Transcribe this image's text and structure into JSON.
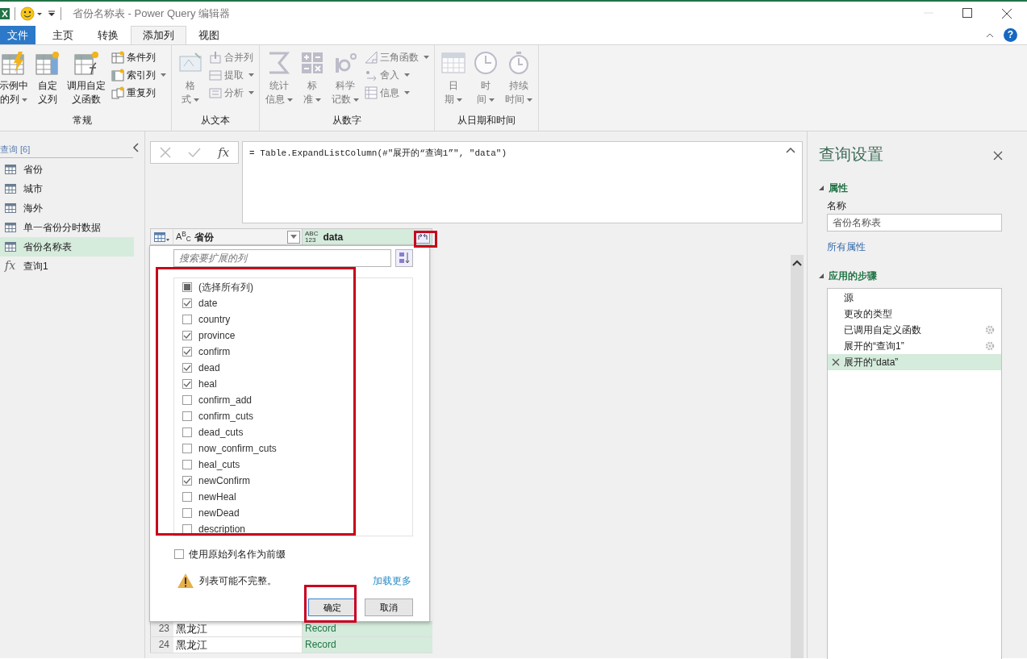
{
  "window": {
    "title": "省份名称表 - Power Query 编辑器"
  },
  "ribbon_tabs": [
    {
      "label": "文件",
      "kind": "file",
      "selected": false
    },
    {
      "label": "主页",
      "kind": "tab",
      "selected": false
    },
    {
      "label": "转换",
      "kind": "tab",
      "selected": false
    },
    {
      "label": "添加列",
      "kind": "tab",
      "selected": true
    },
    {
      "label": "视图",
      "kind": "tab",
      "selected": false
    }
  ],
  "help_button": {
    "glyph": "?"
  },
  "ribbon_groups": [
    {
      "label": "常规",
      "buttons": [
        {
          "kind": "large",
          "lines": [
            "示例中",
            "的列"
          ],
          "dropdown": true,
          "disabled": false
        },
        {
          "kind": "large",
          "lines": [
            "自定",
            "义列"
          ],
          "dropdown": false,
          "disabled": false
        },
        {
          "kind": "large",
          "lines": [
            "调用自定",
            "义函数"
          ],
          "dropdown": false,
          "disabled": false
        },
        {
          "kind": "small",
          "lines": [
            "条件列"
          ],
          "dropdown": false,
          "disabled": false
        },
        {
          "kind": "small",
          "lines": [
            "索引列"
          ],
          "dropdown": true,
          "disabled": false
        },
        {
          "kind": "small",
          "lines": [
            "重复列"
          ],
          "dropdown": false,
          "disabled": false
        }
      ]
    },
    {
      "label": "从文本",
      "buttons": [
        {
          "kind": "large",
          "lines": [
            "格",
            "式"
          ],
          "dropdown": true,
          "disabled": true
        },
        {
          "kind": "small",
          "lines": [
            "合并列"
          ],
          "dropdown": false,
          "disabled": true
        },
        {
          "kind": "small",
          "lines": [
            "提取"
          ],
          "dropdown": true,
          "disabled": true
        },
        {
          "kind": "small",
          "lines": [
            "分析"
          ],
          "dropdown": true,
          "disabled": true
        }
      ]
    },
    {
      "label": "从数字",
      "buttons": [
        {
          "kind": "large",
          "lines": [
            "统计",
            "信息"
          ],
          "dropdown": true,
          "disabled": true
        },
        {
          "kind": "large",
          "lines": [
            "标",
            "准"
          ],
          "dropdown": true,
          "disabled": true
        },
        {
          "kind": "large",
          "lines": [
            "科学",
            "记数"
          ],
          "dropdown": true,
          "disabled": true
        },
        {
          "kind": "small",
          "lines": [
            "三角函数"
          ],
          "dropdown": true,
          "disabled": true
        },
        {
          "kind": "small",
          "lines": [
            "舍入"
          ],
          "dropdown": true,
          "disabled": true
        },
        {
          "kind": "small",
          "lines": [
            "信息"
          ],
          "dropdown": true,
          "disabled": true
        }
      ]
    },
    {
      "label": "从日期和时间",
      "buttons": [
        {
          "kind": "large",
          "lines": [
            "日",
            "期"
          ],
          "dropdown": true,
          "disabled": true
        },
        {
          "kind": "large",
          "lines": [
            "时",
            "间"
          ],
          "dropdown": true,
          "disabled": true
        },
        {
          "kind": "large",
          "lines": [
            "持续",
            "时间"
          ],
          "dropdown": true,
          "disabled": true
        }
      ]
    }
  ],
  "queries": {
    "header": "查询 [6]",
    "items": [
      {
        "label": "省份",
        "kind": "table",
        "selected": false
      },
      {
        "label": "城市",
        "kind": "table",
        "selected": false
      },
      {
        "label": "海外",
        "kind": "table",
        "selected": false
      },
      {
        "label": "单一省份分时数据",
        "kind": "table",
        "selected": false
      },
      {
        "label": "省份名称表",
        "kind": "table",
        "selected": true
      },
      {
        "label": "查询1",
        "kind": "function",
        "glyph": "fx",
        "selected": false
      }
    ]
  },
  "formula_bar": {
    "fx_label": "fx",
    "formula": "= Table.ExpandListColumn(#\"展开的“查询1”\", \"data\")"
  },
  "table": {
    "columns": [
      {
        "type_label": "A$^{B}$$_{C}$",
        "name": "省份",
        "kind": "text"
      },
      {
        "type_lines": [
          "ABC",
          "123"
        ],
        "name": "data",
        "kind": "any"
      }
    ],
    "rows": [
      {
        "index": "23",
        "province": "黑龙江",
        "data": "Record"
      },
      {
        "index": "24",
        "province": "黑龙江",
        "data": "Record"
      }
    ]
  },
  "expand_popup": {
    "search_placeholder": "搜索要扩展的列",
    "select_all": {
      "label": "(选择所有列)",
      "indeterminate": true
    },
    "columns": [
      {
        "label": "date",
        "checked": true
      },
      {
        "label": "country",
        "checked": false
      },
      {
        "label": "province",
        "checked": true
      },
      {
        "label": "confirm",
        "checked": true
      },
      {
        "label": "dead",
        "checked": true
      },
      {
        "label": "heal",
        "checked": true
      },
      {
        "label": "confirm_add",
        "checked": false
      },
      {
        "label": "confirm_cuts",
        "checked": false
      },
      {
        "label": "dead_cuts",
        "checked": false
      },
      {
        "label": "now_confirm_cuts",
        "checked": false
      },
      {
        "label": "heal_cuts",
        "checked": false
      },
      {
        "label": "newConfirm",
        "checked": true
      },
      {
        "label": "newHeal",
        "checked": false
      },
      {
        "label": "newDead",
        "checked": false
      },
      {
        "label": "description",
        "checked": false
      }
    ],
    "prefix": {
      "label": "使用原始列名作为前缀",
      "checked": false
    },
    "warning": "列表可能不完整。",
    "load_more": "加载更多",
    "ok": "确定",
    "cancel": "取消"
  },
  "query_settings": {
    "title": "查询设置",
    "properties_heading": "属性",
    "name_label": "名称",
    "name_value": "省份名称表",
    "all_properties": "所有属性",
    "steps_heading": "应用的步骤",
    "steps": [
      {
        "label": "源",
        "has_settings": false,
        "selected": false
      },
      {
        "label": "更改的类型",
        "has_settings": false,
        "selected": false
      },
      {
        "label": "已调用自定义函数",
        "has_settings": true,
        "selected": false
      },
      {
        "label": "展开的“查询1”",
        "has_settings": true,
        "selected": false
      },
      {
        "label": "展开的“data”",
        "has_settings": false,
        "selected": true
      }
    ]
  }
}
